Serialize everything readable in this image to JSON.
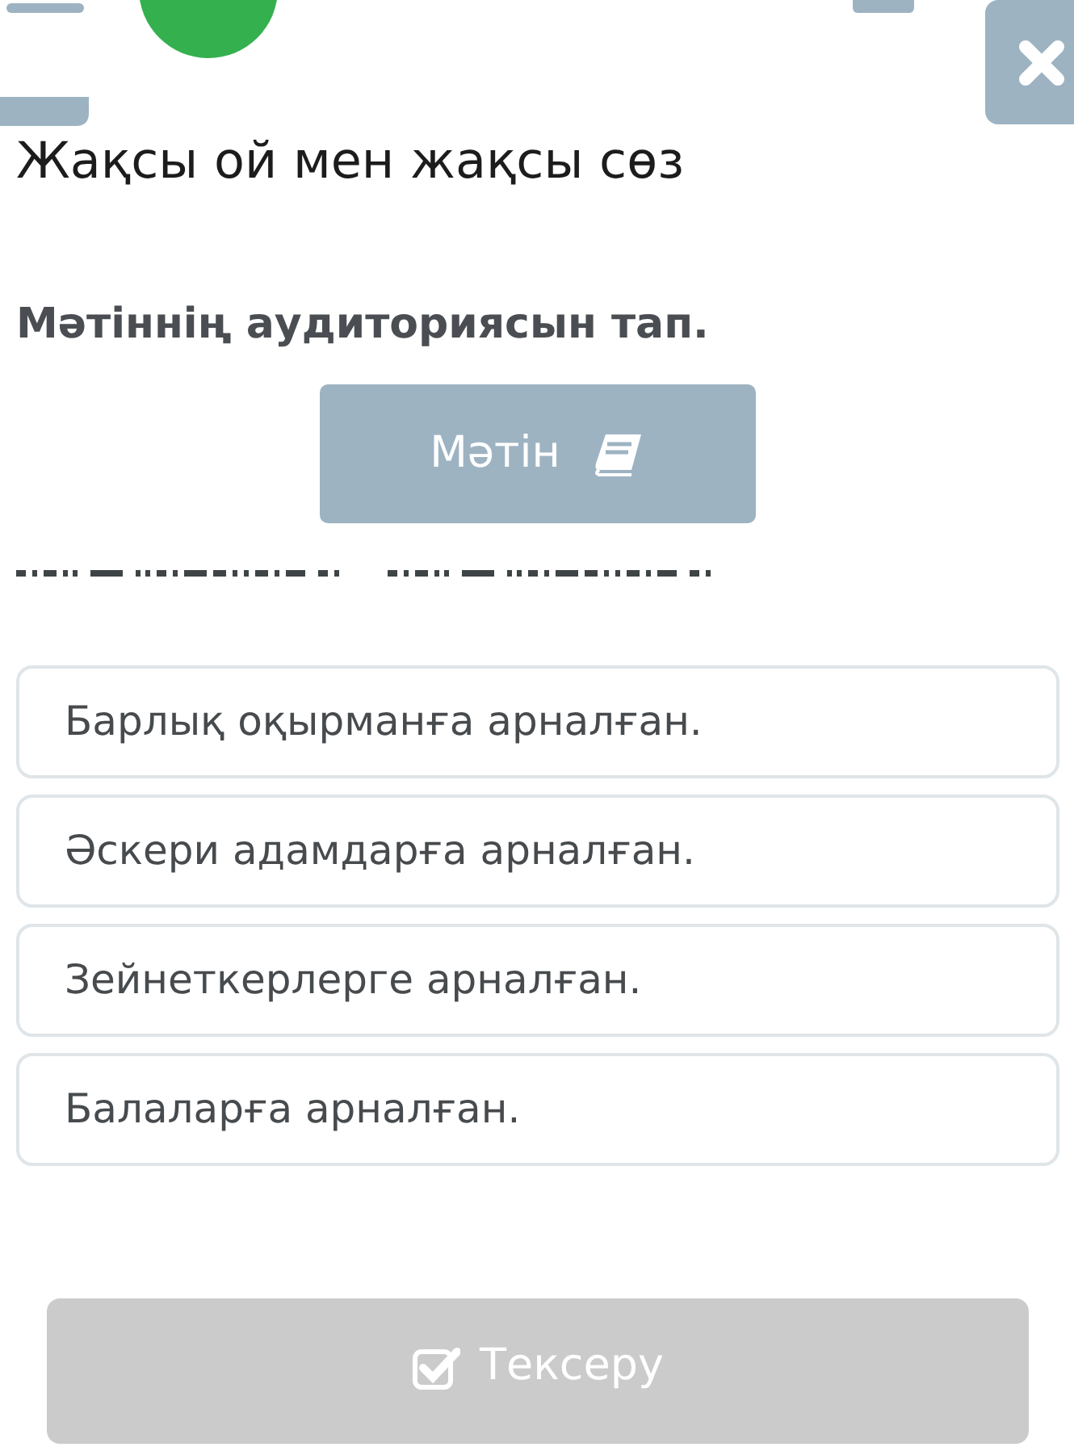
{
  "title": "Жақсы ой мен жақсы сөз",
  "question": "Мәтіннің аудиториясын тап.",
  "text_button": {
    "label": "Мәтін"
  },
  "options": [
    {
      "label": "Барлық оқырманға арналған.",
      "selected": false
    },
    {
      "label": "Әскери адамдарға арналған.",
      "selected": false
    },
    {
      "label": "Зейнеткерлерге арналған.",
      "selected": false
    },
    {
      "label": "Балаларға арналған.",
      "selected": false
    }
  ],
  "check_button": {
    "label": "Тексеру",
    "disabled": true
  }
}
